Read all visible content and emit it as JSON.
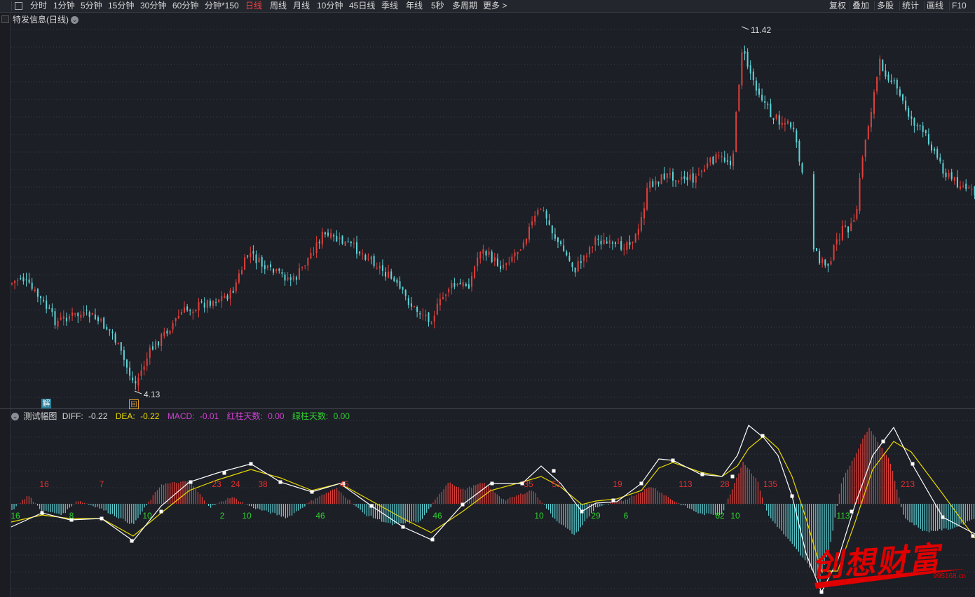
{
  "toolbar": {
    "left_items": [
      "分时",
      "1分钟",
      "5分钟",
      "15分钟",
      "30分钟",
      "60分钟",
      "分钟*150",
      "日线",
      "周线",
      "月线",
      "10分钟",
      "45日线",
      "季线",
      "年线",
      "5秒",
      "多周期",
      "更多 >"
    ],
    "active": "日线",
    "right_items": [
      "复权",
      "叠加",
      "多股",
      "统计",
      "画线",
      "F10"
    ]
  },
  "main_panel": {
    "title": "特发信息(日线)",
    "high_label": "11.42",
    "low_label": "4.13",
    "badge_jie": "解",
    "badge_box": "回"
  },
  "indicator": {
    "name": "测试幅图",
    "diff_label": "DIFF:",
    "diff_value": "-0.22",
    "dea_label": "DEA:",
    "dea_value": "-0.22",
    "macd_label": "MACD:",
    "macd_value": "-0.01",
    "red_label": "红柱天数:",
    "red_value": "0.00",
    "green_label": "绿柱天数:",
    "green_value": "0.00",
    "red_counts": [
      "16",
      "7",
      "23",
      "24",
      "38",
      "45",
      "35",
      "51",
      "19",
      "113",
      "28",
      "135",
      "213"
    ],
    "green_counts": [
      "16",
      "8",
      "10",
      "2",
      "10",
      "46",
      "46",
      "10",
      "29",
      "6",
      "62",
      "10",
      "113"
    ]
  },
  "watermark": {
    "text": "创想财富",
    "url": "995168.cn"
  },
  "colors": {
    "up": "#e0403a",
    "down": "#5fd3d6",
    "diff_line": "#ffffff",
    "dea_line": "#e8d800",
    "red_text": "#e03030",
    "green_text": "#30d030",
    "active_tab": "#ff4040"
  }
}
